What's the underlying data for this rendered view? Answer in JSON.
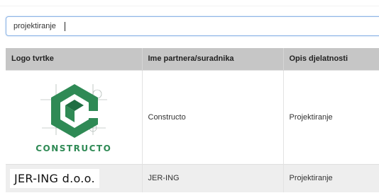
{
  "search": {
    "value": "projektiranje"
  },
  "table": {
    "headers": [
      "Logo tvrtke",
      "Ime partnera/suradnika",
      "Opis djelatnosti"
    ],
    "rows": [
      {
        "logo_text": "CONSTRUCTO",
        "logo_icon": "constructo-logo-icon",
        "name": "Constructo",
        "description": "Projektiranje"
      },
      {
        "logo_text": "JER-ING d.o.o.",
        "name": "JER-ING",
        "description": "Projektiranje"
      }
    ]
  },
  "colors": {
    "header_bg": "#c6c6c6",
    "constructo_green": "#2f8a55",
    "input_focus_border": "#8cb4e6",
    "even_row_bg": "#eeeeee"
  }
}
